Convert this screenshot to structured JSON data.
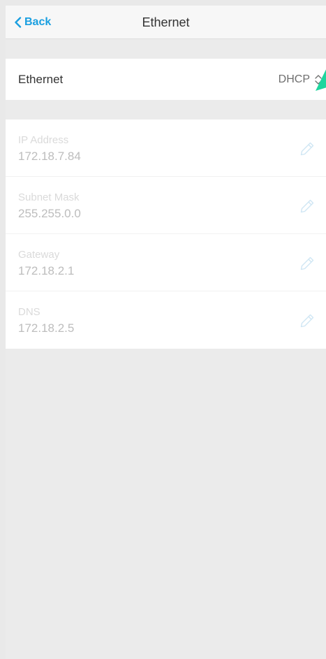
{
  "navbar": {
    "back_label": "Back",
    "back_icon": "chevron-left-icon",
    "title": "Ethernet"
  },
  "connection": {
    "label": "Ethernet",
    "mode": "DHCP",
    "mode_icon": "up-down-chevron-icon"
  },
  "fields": [
    {
      "label": "IP Address",
      "value": "172.18.7.84",
      "icon": "pencil-icon"
    },
    {
      "label": "Subnet Mask",
      "value": "255.255.0.0",
      "icon": "pencil-icon"
    },
    {
      "label": "Gateway",
      "value": "172.18.2.1",
      "icon": "pencil-icon"
    },
    {
      "label": "DNS",
      "value": "172.18.2.5",
      "icon": "pencil-icon"
    }
  ],
  "colors": {
    "accent": "#1a9fe0",
    "pointer": "#1ed69e",
    "edit_icon": "#cfe6f4",
    "background": "#ebebeb"
  }
}
